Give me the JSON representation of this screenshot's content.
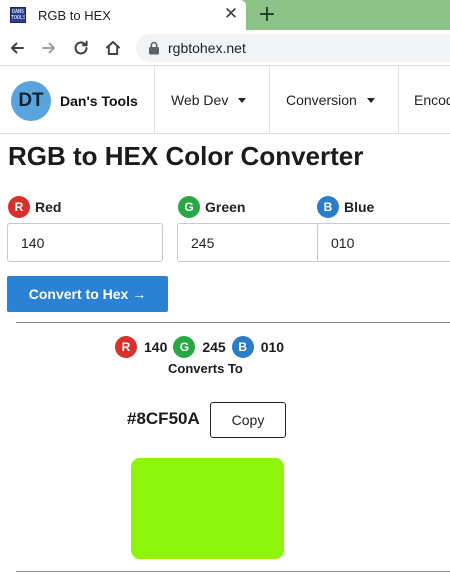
{
  "browser": {
    "tab_title": "RGB to HEX",
    "favicon_text": "DANS TOOLS",
    "url": "rgbtohex.net"
  },
  "navbar": {
    "logo_text": "DT",
    "brand_name": "Dan's Tools",
    "menus": [
      "Web Dev",
      "Conversion",
      "Encod"
    ]
  },
  "page": {
    "title": "RGB to HEX Color Converter",
    "fields": [
      {
        "badge": "R",
        "label": "Red",
        "value": "140"
      },
      {
        "badge": "G",
        "label": "Green",
        "value": "245"
      },
      {
        "badge": "B",
        "label": "Blue",
        "value": "010"
      }
    ],
    "convert_button": "Convert to Hex →"
  },
  "result": {
    "summary": [
      {
        "badge": "R",
        "value": "140"
      },
      {
        "badge": "G",
        "value": "245"
      },
      {
        "badge": "B",
        "value": "010"
      }
    ],
    "converts_to": "Converts To",
    "hex": "#8CF50A",
    "copy_label": "Copy",
    "swatch_color": "#8CF50A"
  },
  "colors": {
    "red_badge": "#d9302c",
    "green_badge": "#27a844",
    "blue_badge": "#2c7dc8",
    "primary_button": "#2b82d4",
    "tab_strip": "#8cc389",
    "logo_circle": "#5aa4de"
  },
  "icons": {
    "back": "arrow-left-icon",
    "forward": "arrow-right-icon",
    "reload": "reload-icon",
    "home": "home-icon",
    "lock": "lock-icon",
    "close_tab": "close-icon",
    "new_tab": "plus-icon",
    "dropdown": "caret-down-icon",
    "arrow": "arrow-right-icon"
  }
}
